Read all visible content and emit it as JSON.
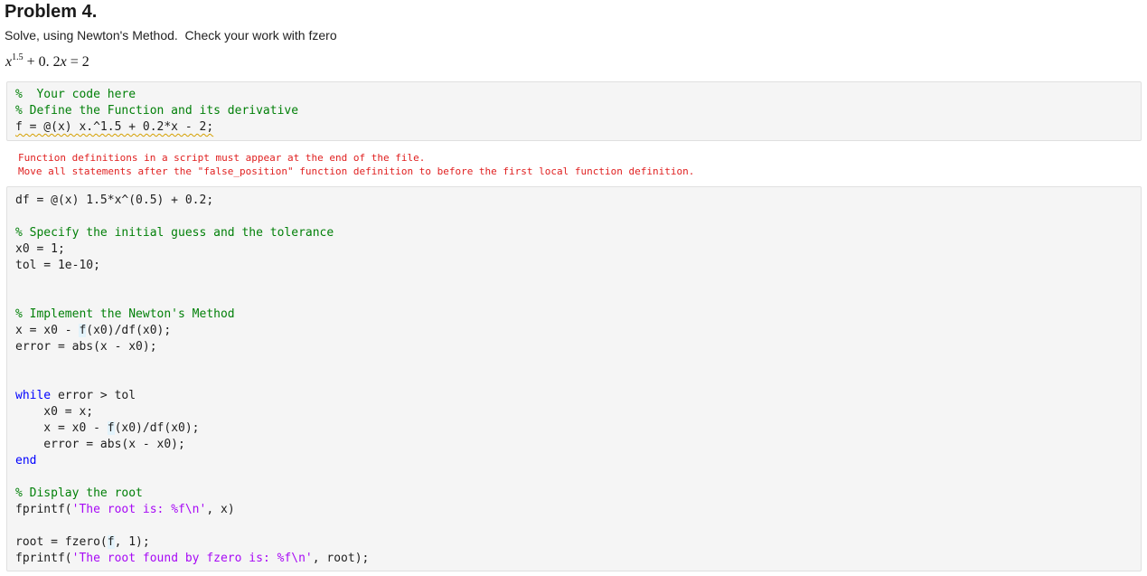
{
  "problem": {
    "title": "Problem 4.",
    "description": "Solve, using Newton's Method.  Check your work with fzero",
    "equation": {
      "base": "x",
      "exponent": "1.5",
      "rest": " + 0. 2",
      "var": "x",
      "tail": " = 2"
    }
  },
  "code_block_1": {
    "lines": [
      {
        "c1": "%  Your code here"
      },
      {
        "c1": "% Define the Function and its derivative"
      },
      {
        "s1": "f = @(x) x.^1.5 + 0.2*x - 2;"
      }
    ]
  },
  "error": {
    "line1": "Function definitions in a script must appear at the end of the file.",
    "line2": "Move all statements after the \"false_position\" function definition to before the first local function definition."
  },
  "code_block_2": {
    "l1": "df = @(x) 1.5*x^(0.5) + 0.2;",
    "l3": "% Specify the initial guess and the tolerance",
    "l4": "x0 = 1;",
    "l5": "tol = 1e-10;",
    "l8": "% Implement the Newton's Method",
    "l9a": "x = x0 - ",
    "l9b": "f",
    "l9c": "(x0)/df(x0);",
    "l10": "error = abs(x - x0);",
    "l13a": "while",
    "l13b": " error > tol",
    "l14": "    x0 = x;",
    "l15a": "    x = x0 - ",
    "l15b": "f",
    "l15c": "(x0)/df(x0);",
    "l16": "    error = abs(x - x0);",
    "l17": "end",
    "l19": "% Display the root",
    "l20a": "fprintf(",
    "l20b": "'The root is: %f\\n'",
    "l20c": ", x)",
    "l22a": "root = fzero(",
    "l22b": "f",
    "l22c": ", 1);",
    "l23a": "fprintf(",
    "l23b": "'The root found by fzero is: %f\\n'",
    "l23c": ", root);"
  },
  "colors": {
    "comment": "#028009",
    "keyword": "#0000ff",
    "string": "#a709f5",
    "error": "#e02020",
    "code_bg": "#f5f5f5"
  }
}
